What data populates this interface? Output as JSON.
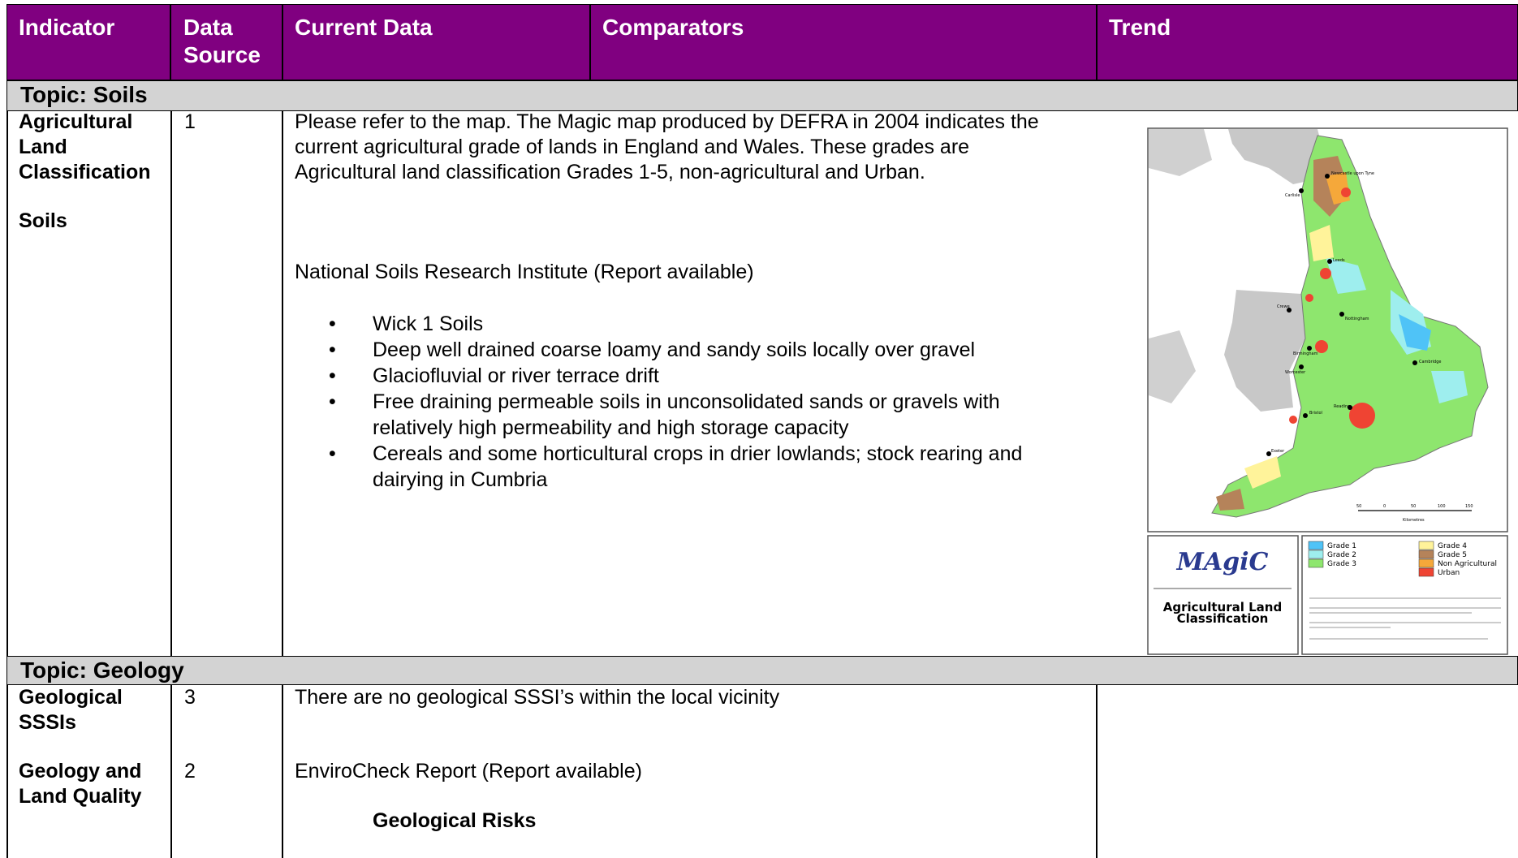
{
  "header": {
    "indicator": "Indicator",
    "data_source_line1": "Data",
    "data_source_line2": "Source",
    "current_data": "Current Data",
    "comparators": "Comparators",
    "trend": "Trend"
  },
  "soils": {
    "topic": "Topic: Soils",
    "indicator_1_line1": "Agricultural",
    "indicator_1_line2": "Land",
    "indicator_1_line3": "Classification",
    "indicator_2": "Soils",
    "source_1": "1",
    "text_line1": "Please refer to the map. The Magic map produced by DEFRA in 2004 indicates the",
    "text_line2": "current agricultural grade of lands in England and Wales. These grades are",
    "text_line3": "Agricultural land classification Grades 1-5, non-agricultural and Urban.",
    "nsri": "National Soils Research Institute  (Report available)",
    "bullets": [
      {
        "l1": "Wick 1 Soils",
        "l2": ""
      },
      {
        "l1": "Deep well drained coarse loamy and sandy soils locally over gravel",
        "l2": ""
      },
      {
        "l1": "Glaciofluvial or river terrace drift",
        "l2": ""
      },
      {
        "l1": "Free draining permeable soils in unconsolidated sands or gravels with",
        "l2": "relatively high permeability and high storage capacity"
      },
      {
        "l1": "Cereals and some horticultural crops in drier lowlands; stock rearing and",
        "l2": "dairying in Cumbria"
      }
    ],
    "bullet_char": "•"
  },
  "map": {
    "logo": "MAgiC",
    "caption_line1": "Agricultural Land",
    "caption_line2": "Classification",
    "legend": [
      {
        "label": "Grade 1",
        "color": "#4fc3f7"
      },
      {
        "label": "Grade 2",
        "color": "#9eeeee"
      },
      {
        "label": "Grade 3",
        "color": "#8ee66e"
      },
      {
        "label": "Grade 4",
        "color": "#fff39a"
      },
      {
        "label": "Grade 5",
        "color": "#b5835a"
      },
      {
        "label": "Non Agricultural",
        "color": "#f5a83a"
      },
      {
        "label": "Urban",
        "color": "#ef4433"
      }
    ],
    "cities": [
      "Newcastle upon Tyne",
      "Carlisle",
      "Leeds",
      "Crewe",
      "Nottingham",
      "Birmingham",
      "Worcester",
      "Cambridge",
      "Bristol",
      "Reading",
      "Exeter"
    ],
    "scale_ticks": [
      "50",
      "0",
      "50",
      "100",
      "150"
    ],
    "scale_unit": "Kilometres",
    "colors": {
      "land_grey": "#c8c8c8"
    }
  },
  "geology": {
    "topic": "Topic: Geology",
    "indicator_1_line1": "Geological",
    "indicator_1_line2": "SSSIs",
    "indicator_2_line1": "Geology and",
    "indicator_2_line2": "Land Quality",
    "source_1": "3",
    "source_2": "2",
    "text_1": "There are no geological SSSI’s within the local vicinity",
    "text_2": "EnviroCheck Report (Report available)",
    "risks_heading": "Geological Risks"
  },
  "colors": {
    "header_bg": "#800080",
    "topic_bg": "#d3d3d3"
  }
}
